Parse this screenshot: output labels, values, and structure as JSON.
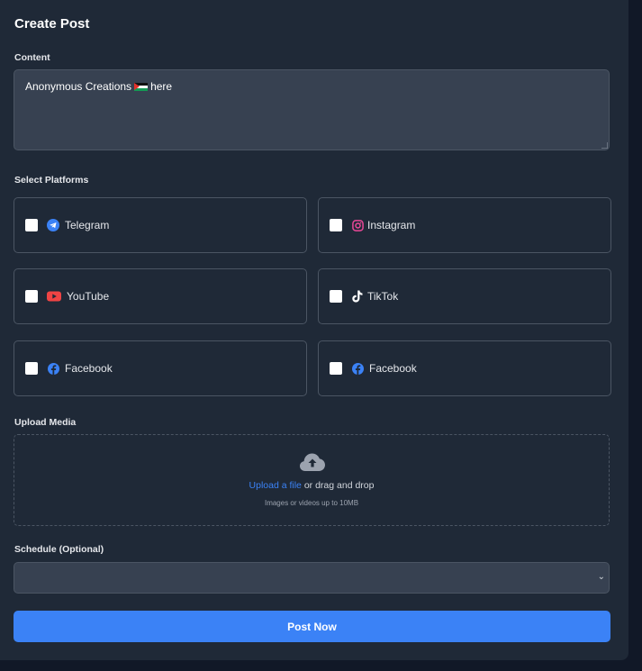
{
  "form": {
    "title": "Create Post",
    "content_label": "Content",
    "content_value_before": "Anonymous Creations",
    "content_flag_icon": "palestine-flag-emoji",
    "content_value_after": "here",
    "platforms_label": "Select Platforms",
    "platforms": [
      {
        "label": "Telegram",
        "icon": "telegram-icon",
        "color": "#3b82f6"
      },
      {
        "label": "Instagram",
        "icon": "instagram-icon",
        "color": "#ec4899"
      },
      {
        "label": "YouTube",
        "icon": "youtube-icon",
        "color": "#ef4444"
      },
      {
        "label": "TikTok",
        "icon": "tiktok-icon",
        "color": "#ffffff"
      },
      {
        "label": "Facebook",
        "icon": "facebook-icon",
        "color": "#3b82f6"
      },
      {
        "label": "Facebook",
        "icon": "facebook-icon",
        "color": "#3b82f6"
      }
    ],
    "upload_label": "Upload Media",
    "upload_link": "Upload a file",
    "upload_text": " or drag and drop",
    "upload_hint": "Images or videos up to 10MB",
    "schedule_label": "Schedule (Optional)",
    "schedule_value": "",
    "submit_label": "Post Now"
  },
  "colors": {
    "page_bg": "#111827",
    "card_bg": "#1f2937",
    "field_bg": "#374151",
    "accent": "#3b82f6"
  }
}
